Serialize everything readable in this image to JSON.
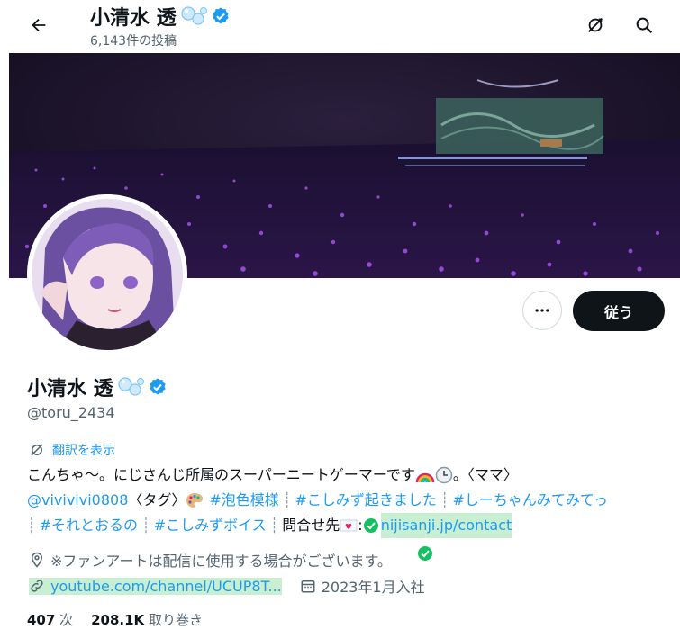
{
  "header": {
    "title": "小清水 透",
    "post_count": "6,143件の投稿"
  },
  "profile": {
    "name": "小清水 透",
    "handle": "@toru_2434",
    "follow_label": "従う",
    "translate_label": "翻訳を表示",
    "bio": {
      "line1": "こんちゃ〜。にじさんじ所属のスーパーニートゲーマーです",
      "line1_end": "。〈ママ〉",
      "mama_link": "@vivivivi0808",
      "tag_text": "〈タグ〉",
      "tag1": "#泡色模様",
      "tag2": "#こしみず起きました",
      "tag3": "#しーちゃんみてみてっ",
      "tag4": "#それとおるの",
      "tag5": "#こしみずボイス",
      "contact_label": "問合せ先",
      "contact_link": "nijisanji.jp/contact"
    },
    "location": "※ファンアートは配信に使用する場合がございます。",
    "website": "youtube.com/channel/UCUP8T...",
    "joined": "2023年1月入社",
    "following_count": "407",
    "following_label": "次",
    "followers_count": "208.1K",
    "followers_label": "取り巻き"
  },
  "colors": {
    "accent": "#1d9bf0",
    "verified": "#1d9bf0",
    "highlight": "#c8efd2",
    "banner_bg": "#140d20",
    "glowstick": "#b45cff"
  },
  "icons": [
    "back-arrow-icon",
    "no-translate-icon",
    "search-icon",
    "bubbles-icon",
    "verified-badge-icon",
    "more-icon",
    "translate-icon",
    "rainbow-icon",
    "clock-icon",
    "palette-icon",
    "heart-letter-icon",
    "green-check-icon",
    "location-icon",
    "link-icon",
    "calendar-icon"
  ]
}
